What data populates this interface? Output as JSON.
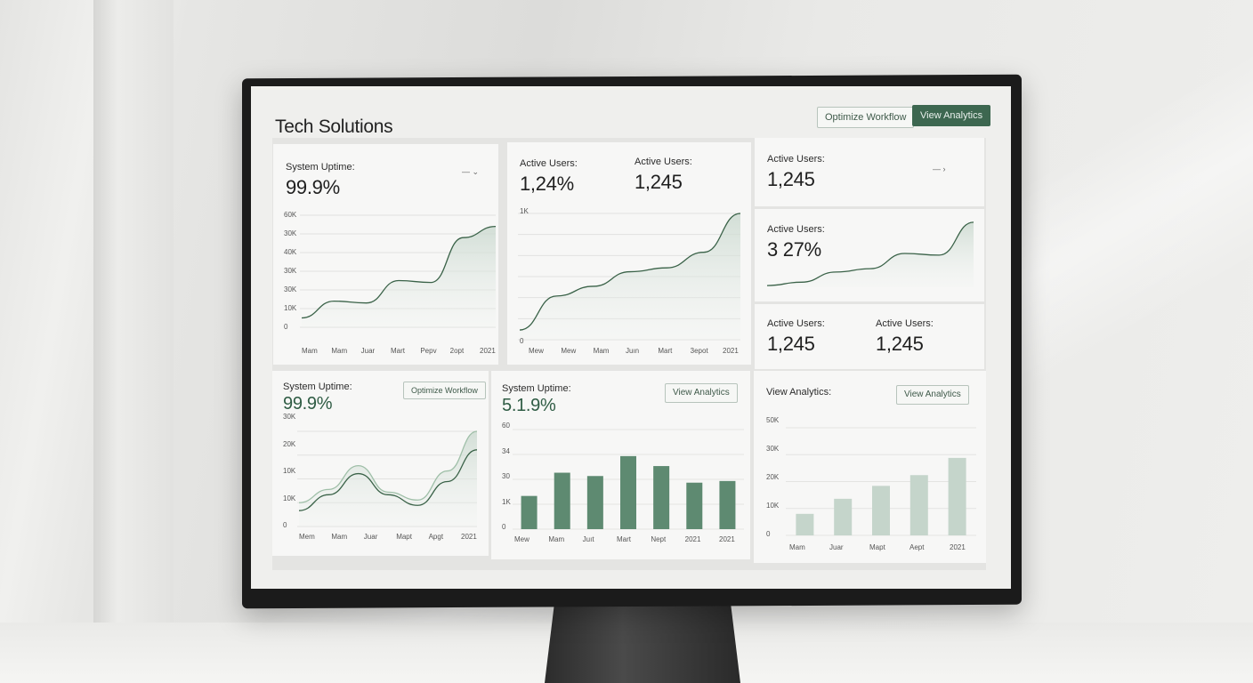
{
  "app": {
    "title": "Tech Solutions"
  },
  "header": {
    "optimize_label": "Optimize Workflow",
    "analytics_label": "View Analytics"
  },
  "colors": {
    "accent": "#3d6750",
    "line": "#3a6248",
    "bar_dark": "#5e8a71",
    "bar_light": "#c5d5cb"
  },
  "cards": {
    "uptime_top": {
      "label": "System Uptime:",
      "value": "99.9%",
      "control": "—  ⌄",
      "y_ticks": [
        "60K",
        "30K",
        "40K",
        "30K",
        "30K",
        "10K",
        "0"
      ],
      "x_ticks": [
        "Mam",
        "Mam",
        "Juar",
        "Mart",
        "Pepv",
        "2opt",
        "2021"
      ]
    },
    "active_pair": {
      "label_a": "Active Users:",
      "value_a": "1,24%",
      "label_b": "Active Users:",
      "value_b": "1,245",
      "y_ticks": [
        "1K",
        "0"
      ],
      "x_ticks": [
        "Mew",
        "Mew",
        "Mam",
        "Juın",
        "Mart",
        "3epot",
        "2021"
      ]
    },
    "active_right_top": {
      "label": "Active Users:",
      "value": "1,245",
      "control": "—  ›"
    },
    "active_right_mid": {
      "label": "Active Users:",
      "value": "3 27%"
    },
    "active_right_bottom": {
      "label_a": "Active Users:",
      "value_a": "1,245",
      "label_b": "Active Users:",
      "value_b": "1,245"
    },
    "uptime_bottom": {
      "label": "System Uptime:",
      "value": "99.9%",
      "button": "Optimize Workflow",
      "y_ticks": [
        "30K",
        "20K",
        "10K",
        "10K",
        "0"
      ],
      "x_ticks": [
        "Mem",
        "Mam",
        "Juar",
        "Mapt",
        "Apgt",
        "2021"
      ]
    },
    "uptime_bars": {
      "label": "System Uptime:",
      "value": "5.1.9%",
      "button": "View Analytics",
      "y_ticks": [
        "60",
        "34",
        "30",
        "1K",
        "0"
      ],
      "x_ticks": [
        "Mew",
        "Mam",
        "Juıt",
        "Mart",
        "Nept",
        "2021",
        "2021"
      ]
    },
    "analytics_bars": {
      "label": "View Analytics:",
      "button": "View Analytics",
      "y_ticks": [
        "50K",
        "30K",
        "20K",
        "10K",
        "0"
      ],
      "x_ticks": [
        "Mam",
        "Juar",
        "Mapt",
        "Aept",
        "2021"
      ]
    }
  },
  "chart_data": [
    {
      "type": "area",
      "series": [
        {
          "values": [
            5,
            14,
            13,
            25,
            24,
            48,
            54
          ]
        }
      ],
      "ylim": [
        0,
        60
      ]
    },
    {
      "type": "area",
      "series": [
        {
          "values": [
            0.1,
            0.45,
            0.55,
            0.7,
            0.74,
            0.9,
            1.3
          ]
        }
      ],
      "ylim": [
        0,
        1.3
      ]
    },
    {
      "type": "area",
      "series": [
        {
          "values": [
            2,
            6,
            18,
            22,
            40,
            38,
            77
          ]
        }
      ],
      "ylim": [
        0,
        80
      ]
    },
    {
      "type": "line",
      "series": [
        {
          "values": [
            6,
            12,
            20,
            12,
            8,
            17,
            29
          ]
        },
        {
          "values": [
            9,
            14,
            23,
            13,
            10,
            21,
            36
          ]
        }
      ],
      "ylim": [
        0,
        36
      ]
    },
    {
      "type": "bar",
      "values": [
        20,
        34,
        32,
        44,
        38,
        28,
        29
      ],
      "ylim": [
        0,
        60
      ]
    },
    {
      "type": "bar",
      "values": [
        10,
        17,
        23,
        28,
        36
      ],
      "ylim": [
        0,
        50
      ]
    }
  ]
}
